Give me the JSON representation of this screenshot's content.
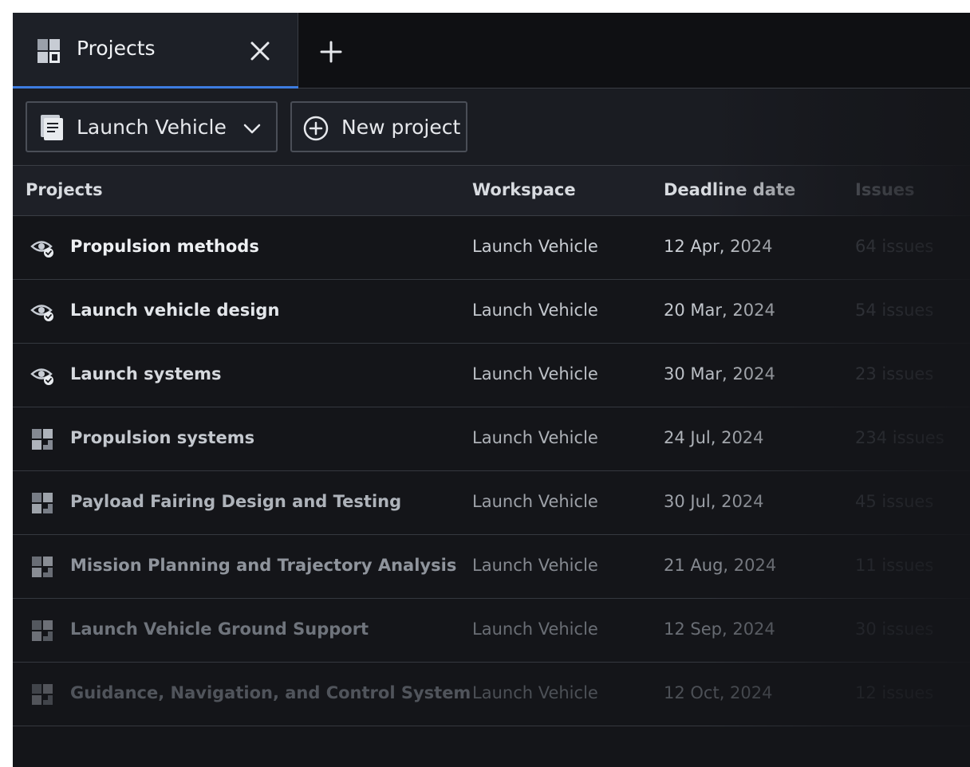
{
  "tabs": [
    {
      "label": "Projects",
      "icon": "projects-icon",
      "active": true
    }
  ],
  "tab_actions": {
    "close_icon": "close-icon",
    "add_icon": "plus-icon"
  },
  "toolbar": {
    "workspace_select": {
      "value": "Launch Vehicle",
      "icon": "document-icon",
      "chevron": "chevron-down-icon"
    },
    "new_project_button": {
      "label": "New project",
      "icon": "plus-circle-icon"
    }
  },
  "table": {
    "columns": [
      "Projects",
      "Workspace",
      "Deadline date",
      "Issues"
    ],
    "rows": [
      {
        "icon": "watched-icon",
        "name": "Propulsion methods",
        "workspace": "Launch Vehicle",
        "deadline": "12 Apr, 2024",
        "issues": "64 issues"
      },
      {
        "icon": "watched-icon",
        "name": "Launch vehicle design",
        "workspace": "Launch Vehicle",
        "deadline": "20 Mar, 2024",
        "issues": "54 issues"
      },
      {
        "icon": "watched-icon",
        "name": "Launch systems",
        "workspace": "Launch Vehicle",
        "deadline": "30 Mar, 2024",
        "issues": "23 issues"
      },
      {
        "icon": "project-icon",
        "name": "Propulsion systems",
        "workspace": "Launch Vehicle",
        "deadline": "24 Jul, 2024",
        "issues": "234 issues"
      },
      {
        "icon": "project-icon",
        "name": "Payload Fairing Design and Testing",
        "workspace": "Launch Vehicle",
        "deadline": "30 Jul, 2024",
        "issues": "45 issues"
      },
      {
        "icon": "project-icon",
        "name": "Mission Planning and Trajectory Analysis",
        "workspace": "Launch Vehicle",
        "deadline": "21 Aug, 2024",
        "issues": "11 issues"
      },
      {
        "icon": "project-icon",
        "name": "Launch Vehicle Ground Support",
        "workspace": "Launch Vehicle",
        "deadline": "12 Sep, 2024",
        "issues": "30 issues"
      },
      {
        "icon": "project-icon",
        "name": "Guidance, Navigation, and Control System",
        "workspace": "Launch Vehicle",
        "deadline": "12 Oct, 2024",
        "issues": "12 issues"
      }
    ]
  },
  "colors": {
    "accent": "#3d7ce0",
    "background": "#141519",
    "header": "#1e2027",
    "border": "#35383f"
  }
}
